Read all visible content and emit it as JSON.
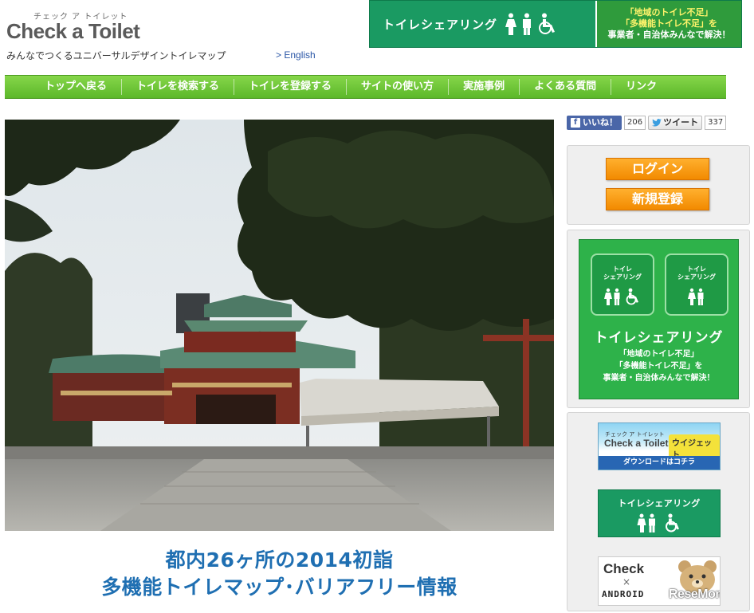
{
  "header": {
    "logo_kana": "チェック ア トイレット",
    "logo_text": "Check a Toilet",
    "tagline": "みんなでつくるユニバーサルデザイントイレマップ",
    "english_link": "> English"
  },
  "top_banner": {
    "title": "トイレシェアリング",
    "desc_line1": "「地域のトイレ不足」",
    "desc_line2": "「多機能トイレ不足」を",
    "desc_line3": "事業者・自治体みんなで解決！"
  },
  "nav": {
    "items": [
      {
        "label": "トップへ戻る"
      },
      {
        "label": "トイレを検索する"
      },
      {
        "label": "トイレを登録する"
      },
      {
        "label": "サイトの使い方"
      },
      {
        "label": "実施事例"
      },
      {
        "label": "よくある質問"
      },
      {
        "label": "リンク"
      }
    ]
  },
  "main": {
    "headline_line1": "都内26ヶ所の2014初詣",
    "headline_line2": "多機能トイレマップ･バリアフリー情報"
  },
  "social": {
    "fb_label": "いいね！",
    "fb_count": "206",
    "tw_label": "ツイート",
    "tw_count": "337"
  },
  "sidebar": {
    "login_label": "ログイン",
    "register_label": "新規登録",
    "share": {
      "tile_label_1": "トイレ",
      "tile_label_2": "シェアリング",
      "title": "トイレシェアリング",
      "desc_line1": "「地域のトイレ不足」",
      "desc_line2": "「多機能トイレ不足」を",
      "desc_line3": "事業者・自治体みんなで解決！"
    },
    "widget": {
      "kana": "チェック ア トイレット",
      "logo": "Check a Toilet",
      "badge": "ウイジェット",
      "download": "ダウンロードはコチラ"
    },
    "green_banner_title": "トイレシェアリング",
    "android_banner": {
      "check": "Check",
      "cross": "×",
      "android": "ANDROID",
      "watermark": "ReseMom"
    }
  },
  "colors": {
    "nav_green": "#6cc63a",
    "banner_green": "#1a9a62",
    "headline_blue": "#1f6fb2",
    "orange": "#f28a00"
  }
}
